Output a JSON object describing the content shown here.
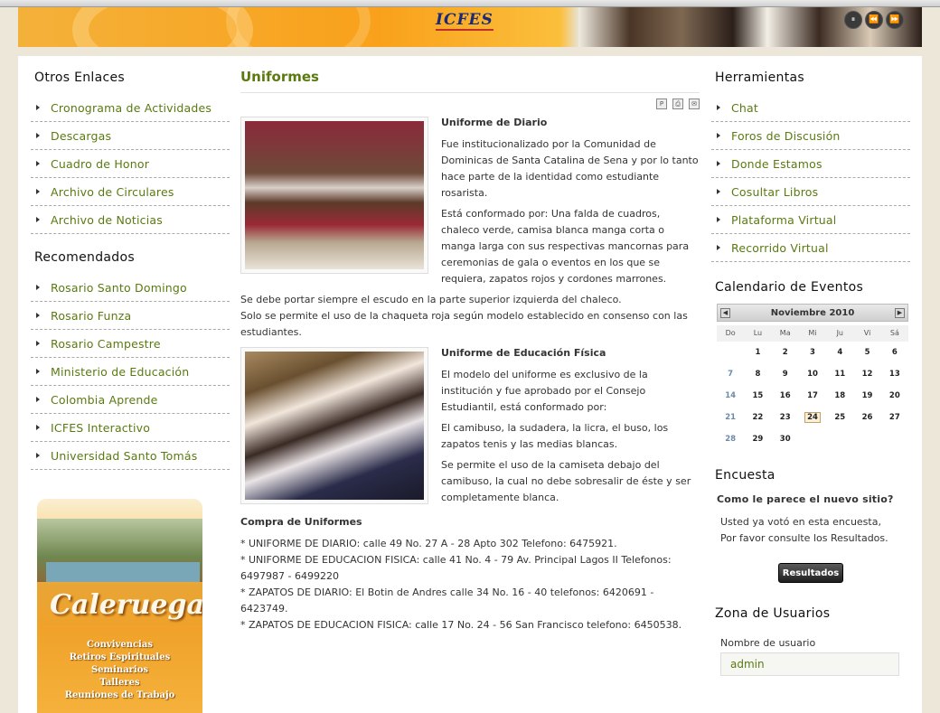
{
  "banner": {
    "logo": "ICFES",
    "controls": [
      "⏸",
      "⏪",
      "⏩"
    ]
  },
  "left": {
    "otros_title": "Otros Enlaces",
    "otros_links": [
      "Cronograma de Actividades",
      "Descargas",
      "Cuadro de Honor",
      "Archivo de Circulares",
      "Archivo de Noticias"
    ],
    "recom_title": "Recomendados",
    "recom_links": [
      "Rosario Santo Domingo",
      "Rosario Funza",
      "Rosario Campestre",
      "Ministerio de Educación",
      "Colombia Aprende",
      "ICFES Interactivo",
      "Universidad Santo Tomás"
    ],
    "ad": {
      "name": "Caleruega",
      "items": [
        "Convivencias",
        "Retiros Espirituales",
        "Seminarios",
        "Talleres",
        "Reuniones de Trabajo"
      ]
    }
  },
  "main": {
    "title": "Uniformes",
    "s1_title": "Uniforme de Diario",
    "s1_p1": "Fue institucionalizado por la Comunidad de Dominicas de Santa Catalina de Sena y por lo tanto hace parte de la identidad como estudiante rosarista.",
    "s1_p2": "Está conformado por: Una falda de cuadros, chaleco verde, camisa blanca manga corta o manga larga con sus respectivas mancornas para ceremonias de gala o eventos en los que se requiera, zapatos rojos y cordones marrones.",
    "s1_p3": "Se debe portar siempre el escudo en la parte superior izquierda del chaleco.",
    "s1_p4": "Solo se permite el uso de la chaqueta roja según modelo establecido en consenso con las estudiantes.",
    "s2_title": "Uniforme de Educación Física",
    "s2_p1": "El modelo del uniforme es exclusivo de la institución y fue aprobado por el Consejo Estudiantil, está conformado por:",
    "s2_p2": "El camibuso, la sudadera, la licra, el buso, los zapatos tenis y las medias blancas.",
    "s2_p3": "Se permite el uso de la camiseta debajo del camibuso, la cual no debe sobresalir de éste y ser completamente blanca.",
    "s3_title": "Compra de Uniformes",
    "s3_lines": [
      "* UNIFORME DE DIARIO: calle 49 No. 27 A - 28 Apto 302 Telefono: 6475921.",
      "* UNIFORME DE EDUCACION FISICA: calle 41 No. 4 - 79 Av. Principal Lagos II Telefonos: 6497987 - 6499220",
      "* ZAPATOS DE DIARIO: El Botin de Andres calle 34 No. 16 - 40 telefonos: 6420691 - 6423749.",
      "* ZAPATOS DE EDUCACION FISICA: calle 17 No. 24 - 56 San Francisco telefono: 6450538."
    ]
  },
  "right": {
    "tools_title": "Herramientas",
    "tools_links": [
      "Chat",
      "Foros de Discusión",
      "Donde Estamos",
      "Cosultar Libros",
      "Plataforma Virtual",
      "Recorrido Virtual"
    ],
    "cal_title": "Calendario de Eventos",
    "cal_month": "Noviembre 2010",
    "cal_days": [
      "Do",
      "Lu",
      "Ma",
      "Mi",
      "Ju",
      "Vi",
      "Sá"
    ],
    "cal_weeks": [
      [
        "",
        "1",
        "2",
        "3",
        "4",
        "5",
        "6"
      ],
      [
        "7",
        "8",
        "9",
        "10",
        "11",
        "12",
        "13"
      ],
      [
        "14",
        "15",
        "16",
        "17",
        "18",
        "19",
        "20"
      ],
      [
        "21",
        "22",
        "23",
        "24",
        "25",
        "26",
        "27"
      ],
      [
        "28",
        "29",
        "30",
        "",
        "",
        "",
        ""
      ]
    ],
    "today": "24",
    "poll_title": "Encuesta",
    "poll_question": "Como le parece el nuevo sitio?",
    "poll_msg_1": "Usted ya votó en esta encuesta,",
    "poll_msg_2": "Por favor consulte los Resultados.",
    "poll_button": "Resultados",
    "users_title": "Zona de Usuarios",
    "username_label": "Nombre de usuario",
    "username_value": "admin"
  },
  "colors": {
    "link": "#5a7a10",
    "title": "#5a7a10",
    "banner": "#f9a11b"
  }
}
